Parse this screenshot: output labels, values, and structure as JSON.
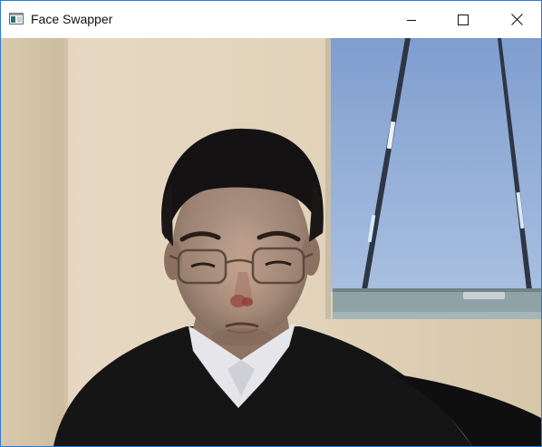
{
  "window": {
    "title": "Face Swapper",
    "icons": {
      "app": "app-window-icon",
      "minimize": "minimize-icon",
      "maximize": "maximize-icon",
      "close": "close-icon"
    },
    "colors": {
      "accent_border": "#2b7bd3",
      "titlebar_bg": "#ffffff"
    }
  },
  "content": {
    "type": "webcam-video-frame"
  }
}
